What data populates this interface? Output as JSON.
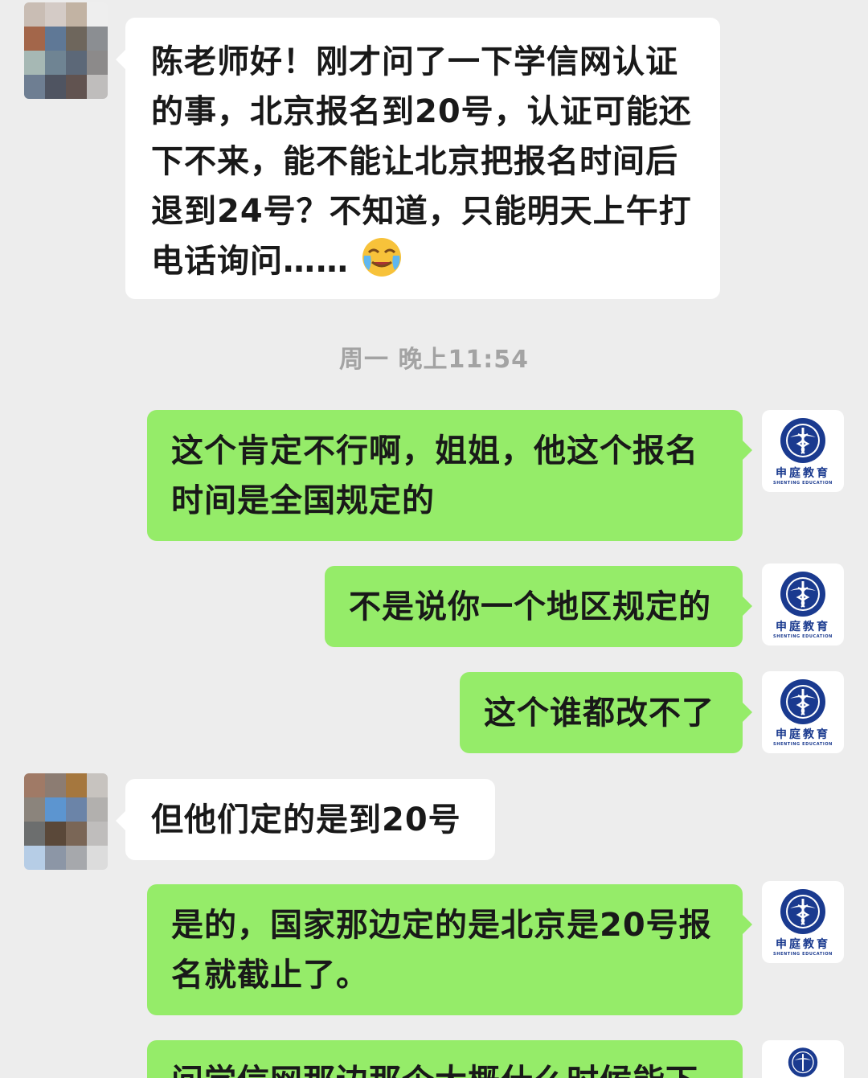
{
  "timestamp": "周一 晚上11:54",
  "colors": {
    "background": "#ededed",
    "incoming_bubble": "#ffffff",
    "outgoing_bubble": "#95ec69",
    "text": "#191919",
    "timestamp": "#a3a3a3",
    "logo_blue": "#1a3a8f"
  },
  "logo": {
    "name": "申庭教育",
    "sub": "SHENTING EDUCATION",
    "icon": "caduceus-seal-icon"
  },
  "messages": [
    {
      "side": "in",
      "lines": [
        "陈老师好！刚才问了一下学信网认证",
        "的事，北京报名到20号，认证可能还",
        "下不来，能不能让北京把报名时间后",
        "退到24号？不知道，只能明天上午打",
        "电话询问……"
      ],
      "emoji": "face-with-tears-emoji"
    },
    {
      "side": "out",
      "lines": [
        "这个肯定不行啊，姐姐，他这个报名",
        "时间是全国规定的"
      ]
    },
    {
      "side": "out",
      "lines": [
        "不是说你一个地区规定的"
      ]
    },
    {
      "side": "out",
      "lines": [
        "这个谁都改不了"
      ]
    },
    {
      "side": "in",
      "lines": [
        "但他们定的是到20号"
      ]
    },
    {
      "side": "out",
      "lines": [
        "是的，国家那边定的是北京是20号报",
        "名就截止了。"
      ]
    },
    {
      "side": "out",
      "lines": [
        "问学信网那边那个大概什么时候能下"
      ]
    }
  ]
}
